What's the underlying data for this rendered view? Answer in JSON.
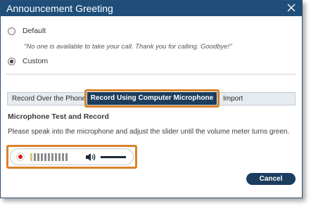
{
  "dialog": {
    "title": "Announcement Greeting"
  },
  "greeting_options": {
    "default": {
      "label": "Default",
      "checked": false
    },
    "default_quote": "\"No one is available to take your call. Thank you for calling. Goodbye!\"",
    "custom": {
      "label": "Custom",
      "checked": true
    }
  },
  "tabs": {
    "phone": "Record Over the Phone",
    "computer": "Record Using Computer Microphone",
    "import": "Import",
    "active": "computer"
  },
  "mic_section": {
    "heading": "Microphone Test and Record",
    "instructions": "Please speak into the microphone and adjust the slider until the volume meter turns green."
  },
  "recorder": {
    "record_icon": "record-icon",
    "speaker_icon": "speaker-volume-icon",
    "meter_segments": 11,
    "meter_lit": 1,
    "volume_level": 1.0
  },
  "footer": {
    "cancel_label": "Cancel"
  },
  "colors": {
    "titlebar": "#1f4e7a",
    "active_tab": "#1b3d5e",
    "highlight": "#d9822b",
    "record_red": "#e01414"
  }
}
